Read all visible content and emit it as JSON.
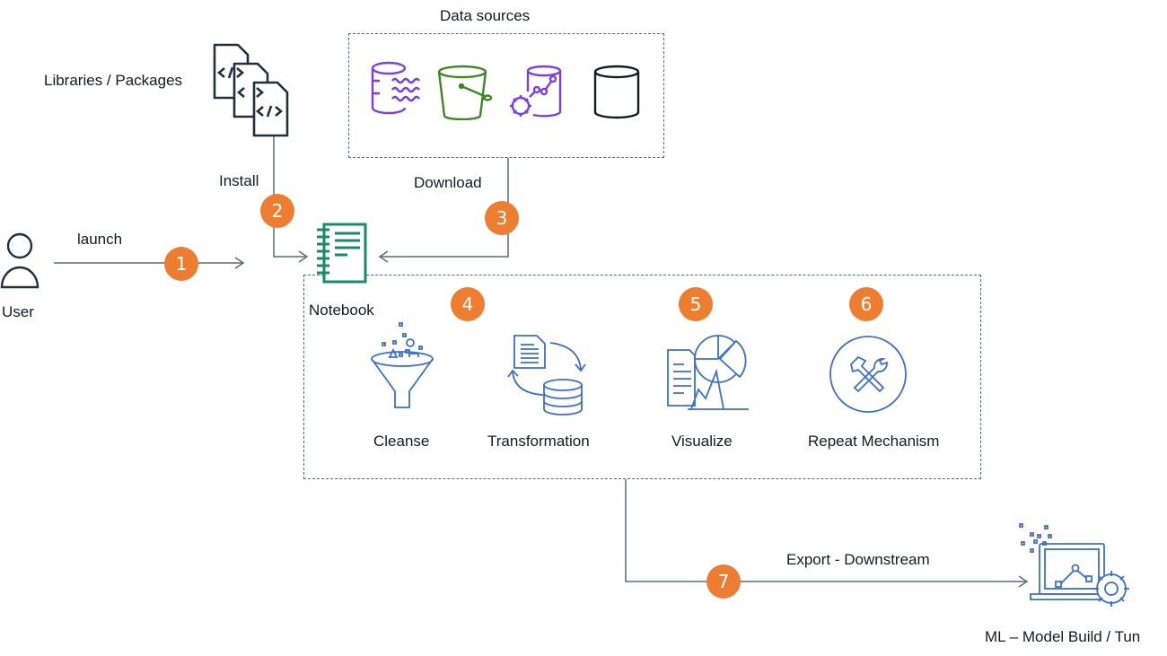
{
  "diagram": {
    "nodes": {
      "user": {
        "label": "User",
        "icon": "user-icon"
      },
      "libraries": {
        "label": "Libraries / Packages",
        "icon": "code-files-icon"
      },
      "data_sources": {
        "label": "Data sources",
        "items": [
          {
            "icon": "database-stream-icon",
            "color": "#7b3fe4"
          },
          {
            "icon": "s3-bucket-icon",
            "color": "#3f8624"
          },
          {
            "icon": "ml-database-icon",
            "color": "#7b3fe4"
          },
          {
            "icon": "generic-database-icon",
            "color": "#16191f"
          }
        ]
      },
      "notebook": {
        "label": "Notebook",
        "icon": "notebook-icon",
        "color": "#1a8a6b"
      },
      "cleanse": {
        "label": "Cleanse",
        "icon": "funnel-icon"
      },
      "transformation": {
        "label": "Transformation",
        "icon": "transform-cycle-icon"
      },
      "visualize": {
        "label": "Visualize",
        "icon": "chart-report-icon"
      },
      "repeat": {
        "label": "Repeat Mechanism",
        "icon": "tools-icon"
      },
      "ml": {
        "label": "ML – Model Build / Tun",
        "icon": "ml-laptop-gear-icon"
      }
    },
    "edges": {
      "launch": {
        "label": "launch",
        "step": "1"
      },
      "install": {
        "label": "Install",
        "step": "2"
      },
      "download": {
        "label": "Download",
        "step": "3"
      },
      "export": {
        "label": "Export - Downstream",
        "step": "7"
      }
    },
    "steps": {
      "cleanse_transform": "4",
      "visualize": "5",
      "repeat": "6"
    },
    "colors": {
      "badge": "#ed7d31",
      "line": "#5a6a85",
      "icon_blue": "#3b6fd4"
    }
  }
}
